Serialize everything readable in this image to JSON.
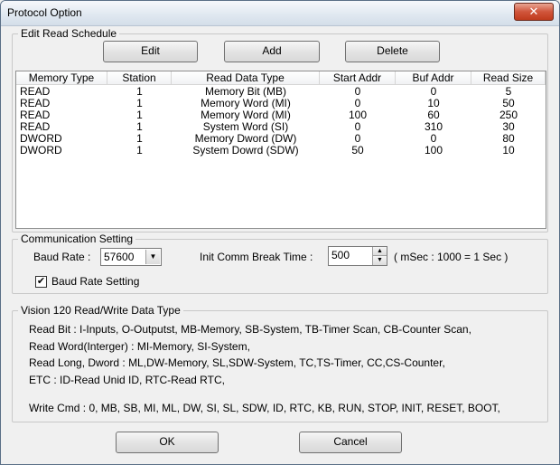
{
  "window": {
    "title": "Protocol Option",
    "close_glyph": "✕"
  },
  "schedule": {
    "legend": "Edit Read Schedule",
    "edit_label": "Edit",
    "add_label": "Add",
    "delete_label": "Delete",
    "columns": [
      "Memory Type",
      "Station",
      "Read Data Type",
      "Start Addr",
      "Buf Addr",
      "Read Size"
    ],
    "rows": [
      [
        "READ",
        "1",
        "Memory Bit (MB)",
        "0",
        "0",
        "5"
      ],
      [
        "READ",
        "1",
        "Memory Word (MI)",
        "0",
        "10",
        "50"
      ],
      [
        "READ",
        "1",
        "Memory Word (MI)",
        "100",
        "60",
        "250"
      ],
      [
        "READ",
        "1",
        "System Word (SI)",
        "0",
        "310",
        "30"
      ],
      [
        "DWORD",
        "1",
        "Memory Dword (DW)",
        "0",
        "0",
        "80"
      ],
      [
        "DWORD",
        "1",
        "System Dowrd (SDW)",
        "50",
        "100",
        "10"
      ]
    ]
  },
  "comm": {
    "legend": "Communication Setting",
    "baud_label": "Baud Rate :",
    "baud_value": "57600",
    "break_label": "Init Comm Break Time :",
    "break_value": "500",
    "break_hint": "( mSec : 1000 = 1 Sec )",
    "baud_setting_label": "Baud Rate Setting",
    "baud_setting_checked": true
  },
  "vision": {
    "legend": "Vision 120 Read/Write Data Type",
    "lines": [
      "Read Bit : I-Inputs, O-Outputst, MB-Memory, SB-System, TB-Timer Scan, CB-Counter Scan,",
      "Read Word(Interger) : MI-Memory, SI-System,",
      "Read Long, Dword : ML,DW-Memory, SL,SDW-System, TC,TS-Timer, CC,CS-Counter,",
      "ETC : ID-Read Unid ID, RTC-Read RTC,",
      "Write Cmd : 0, MB, SB, MI, ML, DW, SI, SL, SDW, ID, RTC, KB, RUN, STOP, INIT, RESET, BOOT,"
    ]
  },
  "footer": {
    "ok_label": "OK",
    "cancel_label": "Cancel"
  }
}
